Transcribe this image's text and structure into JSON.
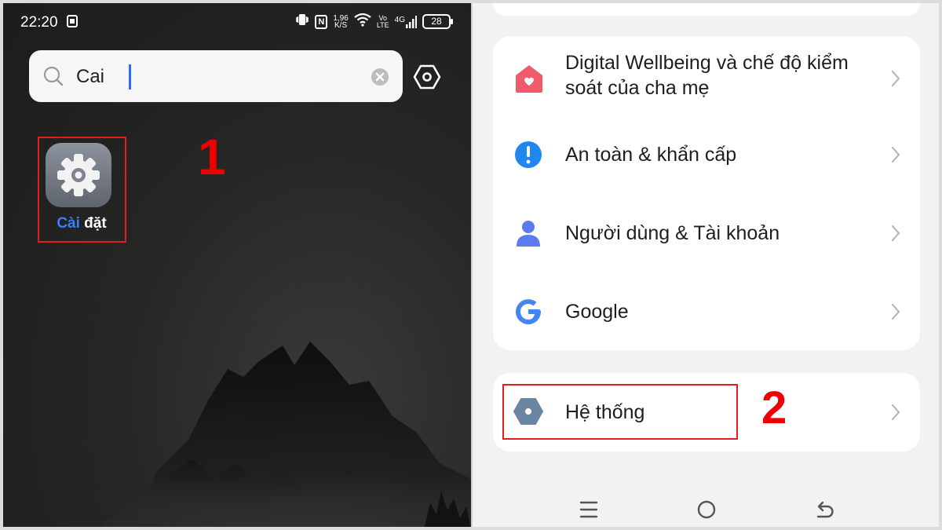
{
  "status": {
    "time": "22:20",
    "net_speed_value": "1,96",
    "net_speed_unit": "K/S",
    "volte_top": "Vo",
    "volte_bottom": "LTE",
    "network": "4G",
    "battery": "28",
    "nfc": "N"
  },
  "search": {
    "query": "Cai"
  },
  "app_result": {
    "label_highlight": "Cài",
    "label_rest": " đặt"
  },
  "annotations": {
    "step1": "1",
    "step2": "2",
    "color": "#e11d1d"
  },
  "settings_list": [
    {
      "label": "Digital Wellbeing và chế độ kiểm soát của cha mẹ",
      "icon": "wellbeing-house-icon",
      "color": "#f05a6a"
    },
    {
      "label": "An toàn & khẩn cấp",
      "icon": "exclamation-circle-icon",
      "color": "#1e88f0"
    },
    {
      "label": "Người dùng & Tài khoản",
      "icon": "user-icon",
      "color": "#5b7cf0"
    },
    {
      "label": "Google",
      "icon": "google-g-icon",
      "color": "#4285f4"
    }
  ],
  "system_item": {
    "label": "Hệ thống",
    "icon": "system-hex-icon",
    "color": "#6b86a3"
  },
  "nav": {
    "items": [
      "menu-icon",
      "home-icon",
      "back-icon"
    ]
  }
}
